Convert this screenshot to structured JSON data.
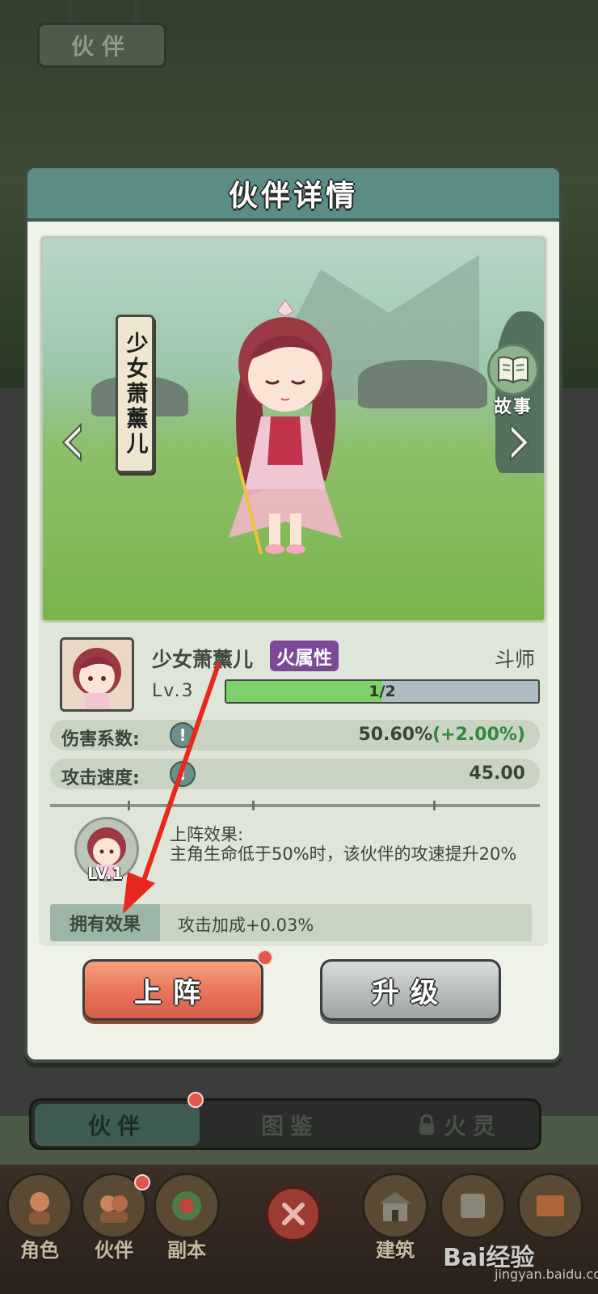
{
  "background": {
    "top_plaque": "伙伴"
  },
  "modal": {
    "title": "伙伴详情",
    "scene": {
      "name_scroll": "少女萧薰儿",
      "story_label": "故事"
    },
    "hero": {
      "name": "少女萧薰儿",
      "attribute": "火属性",
      "rank": "斗师",
      "level": "Lv.3",
      "xp_text": "1/2",
      "xp_progress": 0.5
    },
    "stats": [
      {
        "label": "伤害系数:",
        "value": "50.60%",
        "bonus": "(+2.00%)"
      },
      {
        "label": "攻击速度:",
        "value": "45.00",
        "bonus": ""
      }
    ],
    "deploy_effect": {
      "portrait_level": "LV.1",
      "title": "上阵效果:",
      "description": "主角生命低于50%时，该伙伴的攻速提升20%"
    },
    "own_effect": {
      "label": "拥有效果",
      "value": "攻击加成+0.03%"
    },
    "buttons": {
      "deploy": "上阵",
      "upgrade": "升级"
    }
  },
  "tabs": [
    {
      "label": "伙伴",
      "active": true
    },
    {
      "label": "图鉴",
      "active": false
    },
    {
      "label": "火灵",
      "active": false
    }
  ],
  "bottom_nav": [
    {
      "label": "角色"
    },
    {
      "label": "伙伴"
    },
    {
      "label": "副本"
    },
    {
      "label": "建筑"
    }
  ],
  "watermark": {
    "brand": "Bai经验",
    "url": "jingyan.baidu.com"
  },
  "colors": {
    "header_teal": "#5c8c86",
    "deploy_orange": "#e8735a",
    "upgrade_gray": "#b7bcbd",
    "attribute_purple": "#7b4a96",
    "bonus_green": "#2f8a3a",
    "annotation_red": "#e8281e"
  }
}
